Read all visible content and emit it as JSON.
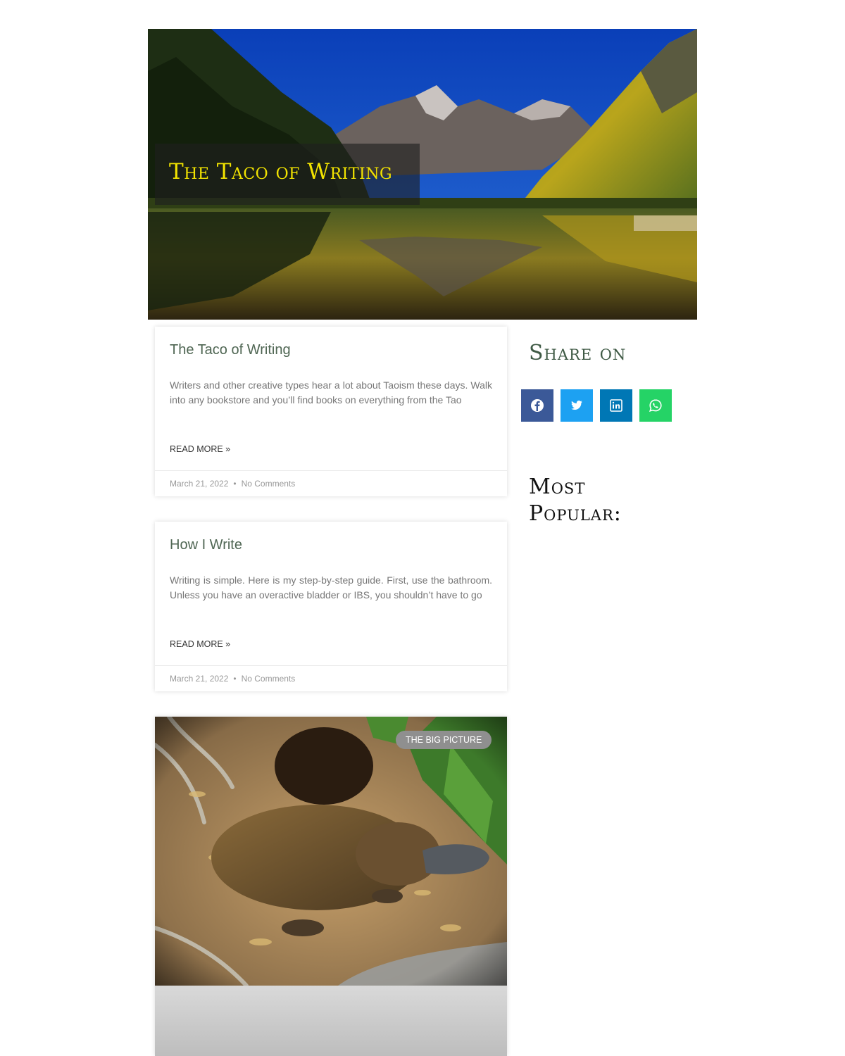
{
  "hero": {
    "title": "The Taco of Writing",
    "image_description": "mountain lake landscape"
  },
  "posts": [
    {
      "title": "The Taco of Writing",
      "excerpt": "Writers and other creative types hear a lot about Taoism these days. Walk into any bookstore and you’ll find books on everything from the Tao",
      "read_more": "READ MORE »",
      "date": "March 21, 2022",
      "separator": "•",
      "comments": "No Comments"
    },
    {
      "title": "How I Write",
      "excerpt": "Writing is simple.  Here is my step-by-step guide. First, use the bathroom.  Unless you have an overactive bladder or IBS, you shouldn’t have to go",
      "read_more": "READ MORE »",
      "date": "March 21, 2022",
      "separator": "•",
      "comments": "No Comments"
    }
  ],
  "featured": {
    "badge": "THE BIG PICTURE"
  },
  "sidebar": {
    "share_heading": "Share on",
    "share_buttons": [
      {
        "icon": "facebook-icon",
        "color": "#3b5998"
      },
      {
        "icon": "twitter-icon",
        "color": "#1da1f2"
      },
      {
        "icon": "linkedin-icon",
        "color": "#0077b5"
      },
      {
        "icon": "whatsapp-icon",
        "color": "#25d366"
      }
    ],
    "popular_heading": "Most Popular:"
  },
  "colors": {
    "hero_title": "#f2e300",
    "post_title": "#4f6653",
    "share_heading": "#3f5a45"
  }
}
